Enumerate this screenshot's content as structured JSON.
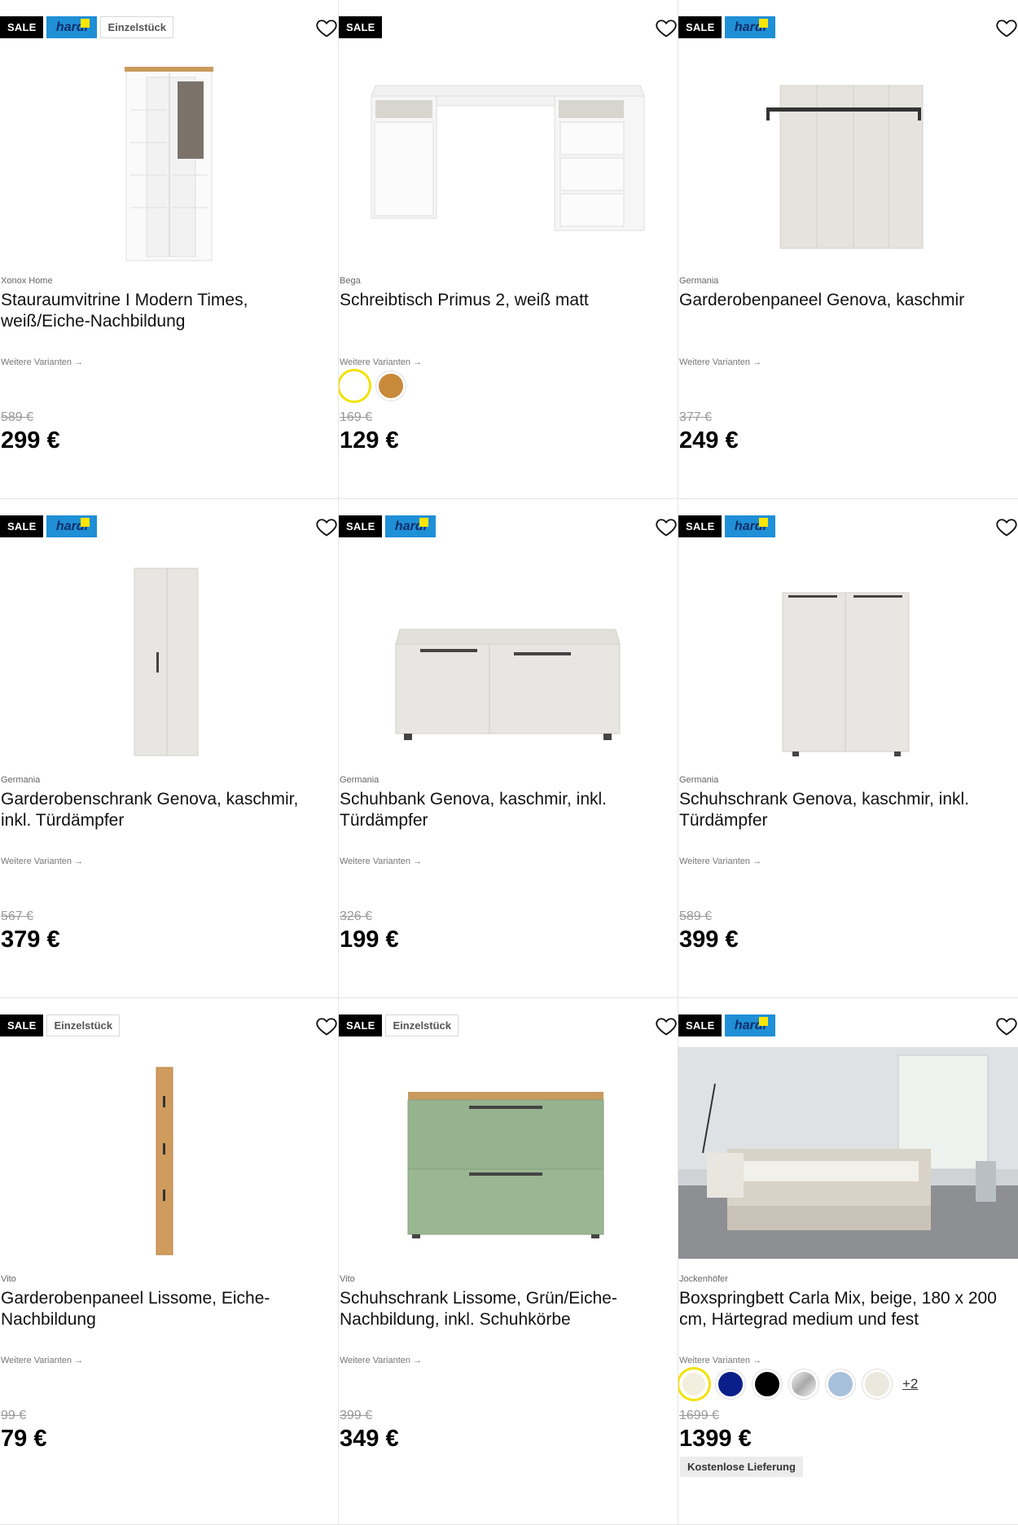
{
  "labels": {
    "sale": "SALE",
    "hardi": "hardi",
    "single": "Einzelstück",
    "variants": "Weitere Varianten →",
    "currency_suffix": " €"
  },
  "products": [
    {
      "brand": "Xonox Home",
      "title": "Stauraumvitrine I Modern Times, weiß/Eiche-Nachbildung",
      "old_price": "589 €",
      "price": "299 €",
      "badges": [
        "sale",
        "hardi",
        "single"
      ]
    },
    {
      "brand": "Bega",
      "title": "Schreibtisch Primus 2, weiß matt",
      "old_price": "169 €",
      "price": "129 €",
      "badges": [
        "sale"
      ],
      "swatches": [
        "#ffffff",
        "#c8893a"
      ]
    },
    {
      "brand": "Germania",
      "title": "Garderobenpaneel Genova, kaschmir",
      "old_price": "377 €",
      "price": "249 €",
      "badges": [
        "sale",
        "hardi"
      ]
    },
    {
      "brand": "Germania",
      "title": "Garderobenschrank Genova, kaschmir, inkl. Türdämpfer",
      "old_price": "567 €",
      "price": "379 €",
      "badges": [
        "sale",
        "hardi"
      ]
    },
    {
      "brand": "Germania",
      "title": "Schuhbank Genova, kaschmir, inkl. Türdämpfer",
      "old_price": "326 €",
      "price": "199 €",
      "badges": [
        "sale",
        "hardi"
      ]
    },
    {
      "brand": "Germania",
      "title": "Schuhschrank Genova, kaschmir, inkl. Türdämpfer",
      "old_price": "589 €",
      "price": "399 €",
      "badges": [
        "sale",
        "hardi"
      ]
    },
    {
      "brand": "Vito",
      "title": "Garderobenpaneel Lissome, Eiche-Nachbildung",
      "old_price": "99 €",
      "price": "79 €",
      "badges": [
        "sale",
        "single"
      ]
    },
    {
      "brand": "Vito",
      "title": "Schuhschrank Lissome, Grün/Eiche-Nachbildung, inkl. Schuhkörbe",
      "old_price": "399 €",
      "price": "349 €",
      "badges": [
        "sale",
        "single"
      ]
    },
    {
      "brand": "Jockenhöfer",
      "title": "Boxspringbett Carla Mix, beige, 180 x 200 cm, Härtegrad medium und fest",
      "old_price": "1699 €",
      "price": "1399 €",
      "badges": [
        "sale",
        "hardi"
      ],
      "swatches": [
        "#f3efdf",
        "#0b1f8a",
        "#000000",
        "#c9c9c9",
        "#a7c0db",
        "#ebe9de"
      ],
      "more": "+2",
      "shipping": "Kostenlose Lieferung"
    }
  ],
  "icons": {
    "wishlist": "heart-outline-icon"
  }
}
